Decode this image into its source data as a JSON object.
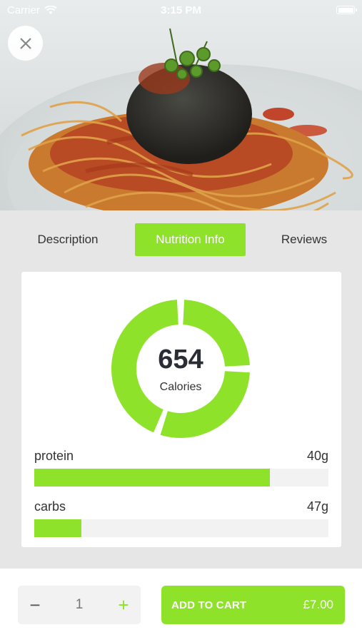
{
  "status_bar": {
    "carrier": "Carrier",
    "time": "3:15 PM"
  },
  "hero": {
    "image": "spaghetti-meatball-photo"
  },
  "tabs": [
    {
      "label": "Description",
      "active": false
    },
    {
      "label": "Nutrition Info",
      "active": true
    },
    {
      "label": "Reviews",
      "active": false
    }
  ],
  "nutrition": {
    "calories_value": "654",
    "calories_label": "Calories",
    "nutrients": [
      {
        "name": "protein",
        "amount": "40g",
        "fraction": 0.8
      },
      {
        "name": "carbs",
        "amount": "47g",
        "fraction": 0.16
      }
    ]
  },
  "order": {
    "minus_symbol": "−",
    "quantity": "1",
    "plus_symbol": "+",
    "add_to_cart_label": "ADD TO CART",
    "price": "£7.00"
  },
  "colors": {
    "accent": "#8ee32a",
    "background": "#e6e6e6"
  },
  "icons": [
    "wifi-icon",
    "battery-icon",
    "close-icon",
    "minus-icon",
    "plus-icon"
  ]
}
